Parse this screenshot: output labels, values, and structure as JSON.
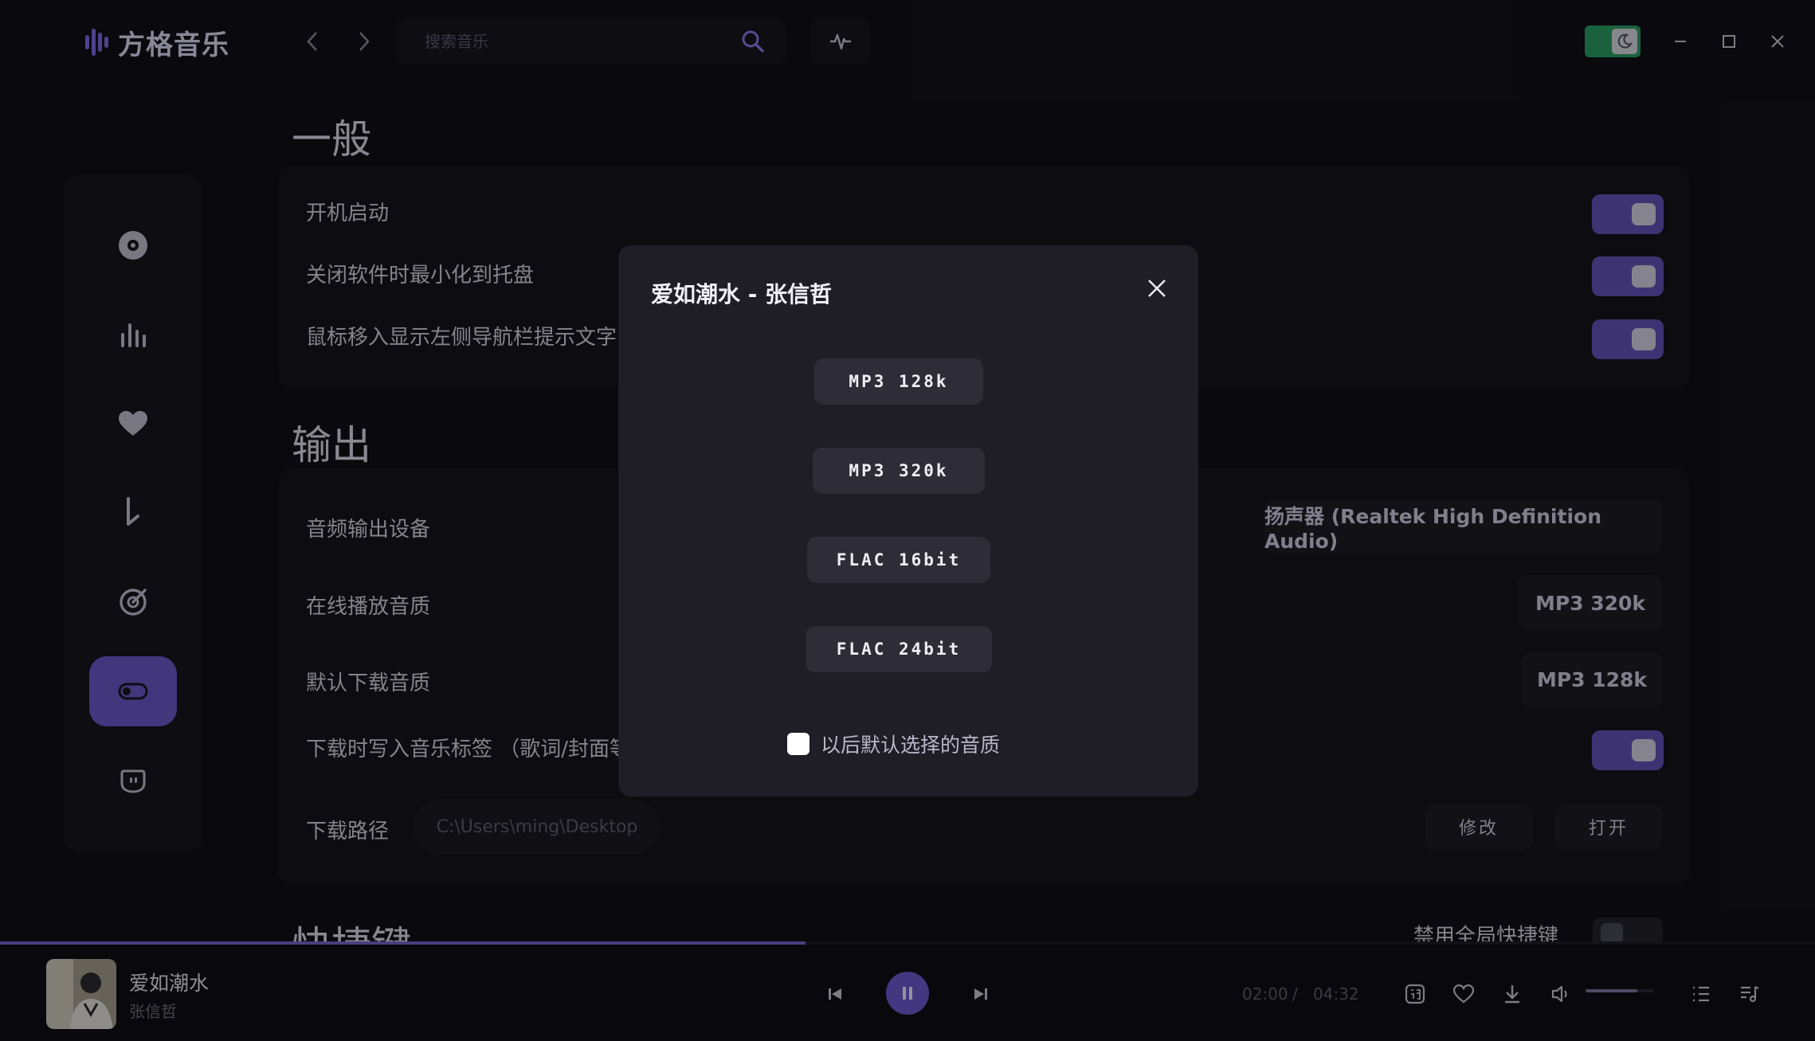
{
  "app": {
    "name": "方格音乐"
  },
  "search": {
    "placeholder": "搜索音乐"
  },
  "sections": {
    "general": {
      "title": "一般",
      "rows": [
        {
          "label": "开机启动",
          "enabled": true
        },
        {
          "label": "关闭软件时最小化到托盘",
          "enabled": true
        },
        {
          "label": "鼠标移入显示左侧导航栏提示文字",
          "enabled": true
        }
      ]
    },
    "output": {
      "title": "输出",
      "device_label": "音频输出设备",
      "device_value": "扬声器 (Realtek High Definition Audio)",
      "online_quality_label": "在线播放音质",
      "online_quality_value": "MP3 320k",
      "download_quality_label": "默认下载音质",
      "download_quality_value": "MP3 128k",
      "write_tags_label": "下载时写入音乐标签 （歌词/封面等）",
      "write_tags_enabled": true,
      "path_label": "下载路径",
      "path_value": "C:\\Users\\ming\\Desktop",
      "modify_label": "修改",
      "open_label": "打开"
    },
    "shortcuts": {
      "title": "快捷键",
      "disable_global_label": "禁用全局快捷键",
      "disable_global_enabled": false
    }
  },
  "modal": {
    "title": "爱如潮水 - 张信哲",
    "options": [
      "MP3 128k",
      "MP3 320k",
      "FLAC 16bit",
      "FLAC 24bit"
    ],
    "remember_label": "以后默认选择的音质",
    "remember_checked": false
  },
  "player": {
    "song": "爱如潮水",
    "artist": "张信哲",
    "current_time": "02:00",
    "separator": "/",
    "total_time": "04:32",
    "progress": 0.444,
    "volume": 0.75
  },
  "colors": {
    "accent": "#6b57c9",
    "switch_on": "#6453b8",
    "theme_toggle": "#2a9e63",
    "background": "#111017"
  },
  "icons": {
    "sidebar": [
      "disc-icon",
      "chart-bars-icon",
      "heart-icon",
      "download-icon",
      "target-disc-icon",
      "toggle-settings-icon",
      "face-icon"
    ]
  }
}
